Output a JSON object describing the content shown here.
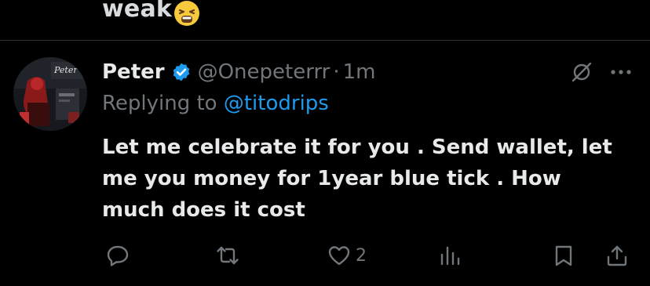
{
  "previous_tweet": {
    "text": "weak",
    "emoji": "tired-face-emoji"
  },
  "reply": {
    "author_name": "Peter",
    "verified": true,
    "handle": "@Onepeterrr",
    "separator": "·",
    "time": "1m",
    "replying_prefix": "Replying to",
    "replying_to": "@titodrips",
    "text": "Let me celebrate it for you . Send wallet, let me you money for 1year blue tick . How much does it cost",
    "avatar_label": "Peter",
    "stats": {
      "likes": "2"
    }
  },
  "icons": {
    "grok": "grok-icon",
    "more": "more-icon",
    "reply": "reply-icon",
    "retweet": "retweet-icon",
    "like": "heart-icon",
    "views": "views-icon",
    "bookmark": "bookmark-icon",
    "share": "share-icon"
  },
  "colors": {
    "background": "#000000",
    "text_primary": "#e7e9ea",
    "text_secondary": "#71767b",
    "accent": "#1d9bf0",
    "divider": "#2f3336"
  }
}
